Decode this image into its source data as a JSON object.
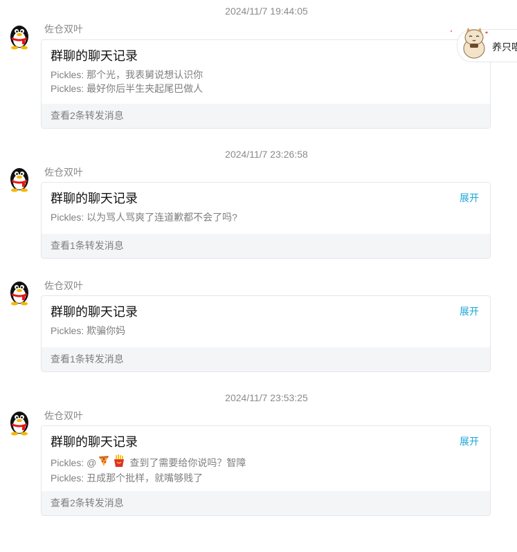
{
  "messages": [
    {
      "timestamp": "2024/11/7 19:44:05",
      "sender": "佐仓双叶",
      "title": "群聊的聊天记录",
      "lines": [
        "Pickles: 那个光，我表舅说想认识你",
        "Pickles: 最好你后半生夹起尾巴做人"
      ],
      "footer": "查看2条转发消息"
    },
    {
      "timestamp": "2024/11/7 23:26:58",
      "sender": "佐仓双叶",
      "title": "群聊的聊天记录",
      "expand": "展开",
      "lines": [
        "Pickles: 以为骂人骂爽了连道歉都不会了吗?"
      ],
      "footer": "查看1条转发消息"
    },
    {
      "sender": "佐仓双叶",
      "title": "群聊的聊天记录",
      "expand": "展开",
      "lines": [
        "Pickles: 欺骗你妈"
      ],
      "footer": "查看1条转发消息"
    },
    {
      "timestamp": "2024/11/7 23:53:25",
      "sender": "佐仓双叶",
      "title": "群聊的聊天记录",
      "expand": "展开",
      "line1_prefix": "Pickles: @",
      "line1_suffix": "查到了需要给你说吗？智障",
      "line1_emojis": [
        "pizza-icon",
        "fries-icon"
      ],
      "line2": "Pickles: 丑成那个批样，就嘴够贱了",
      "footer": "查看2条转发消息"
    }
  ],
  "sticker": {
    "label": "养只喵",
    "icon": "cat-sticker-icon"
  }
}
